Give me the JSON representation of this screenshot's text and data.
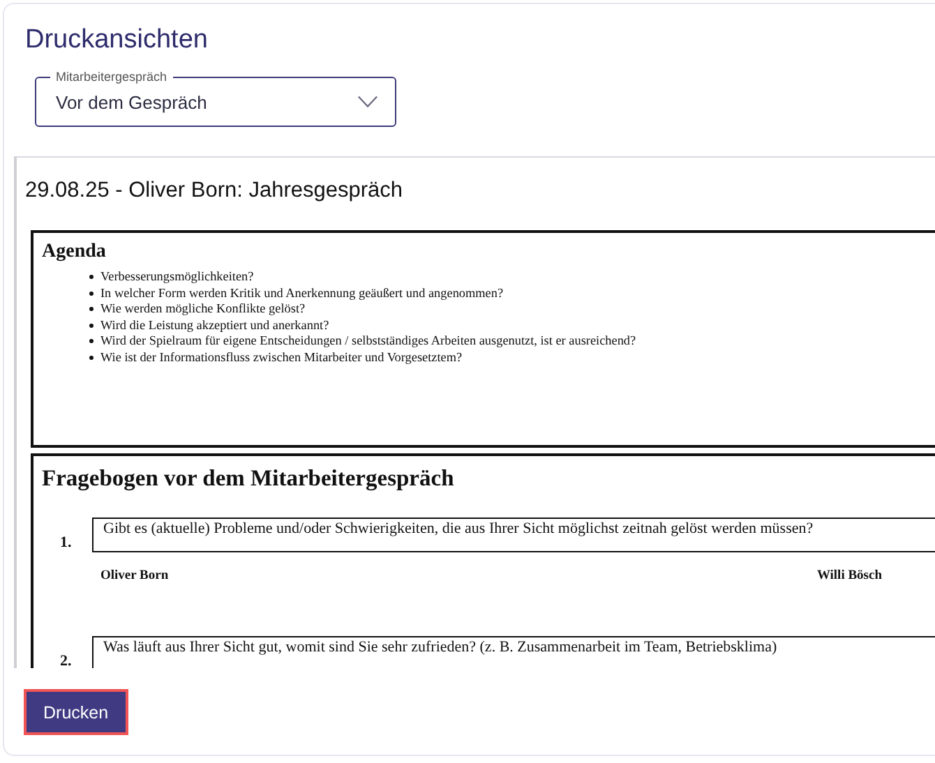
{
  "page": {
    "title": "Druckansichten"
  },
  "select": {
    "label": "Mitarbeitergespräch",
    "value": "Vor dem Gespräch"
  },
  "preview": {
    "heading": "29.08.25 - Oliver Born: Jahresgespräch",
    "agenda": {
      "title": "Agenda",
      "items": [
        "Verbesserungsmöglichkeiten?",
        "In welcher Form werden Kritik und Anerkennung geäußert und angenommen?",
        "Wie werden mögliche Konflikte gelöst?",
        "Wird die Leistung akzeptiert und anerkannt?",
        "Wird der Spielraum für eigene Entscheidungen / selbstständiges Arbeiten ausgenutzt, ist er ausreichend?",
        "Wie ist der Informationsfluss zwischen Mitarbeiter und Vorgesetztem?"
      ]
    },
    "questionnaire": {
      "title": "Fragebogen vor dem Mitarbeitergespräch",
      "questions": [
        {
          "number": "1.",
          "text": "Gibt es (aktuelle) Probleme und/oder Schwierigkeiten, die aus Ihrer Sicht möglichst zeitnah gelöst werden müssen?",
          "answers": [
            "Oliver Born",
            "Willi Bösch"
          ]
        },
        {
          "number": "2.",
          "text": "Was läuft aus Ihrer Sicht gut, womit sind Sie sehr zufrieden? (z. B. Zusammenarbeit im Team, Betriebsklima)"
        }
      ]
    }
  },
  "buttons": [
    {
      "label": "Drucken",
      "focused": true
    }
  ]
}
